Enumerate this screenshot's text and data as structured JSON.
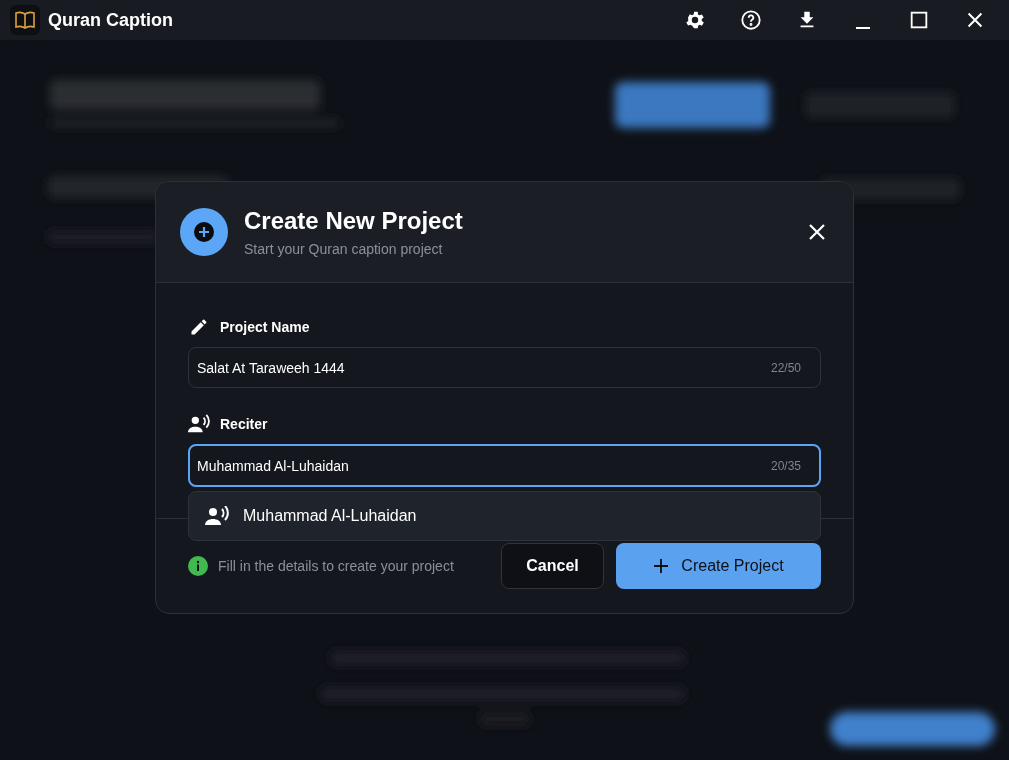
{
  "window": {
    "title": "Quran Caption"
  },
  "dialog": {
    "title": "Create New Project",
    "subtitle": "Start your Quran caption project",
    "fields": [
      {
        "label": "Project Name",
        "kind": "pencil",
        "value": "Salat At Taraweeh 1444",
        "counter": "22/50",
        "focused": false
      },
      {
        "label": "Reciter",
        "kind": "reciter",
        "value": "Muhammad Al-Luhaidan",
        "counter": "20/35",
        "focused": true,
        "suggestions": [
          {
            "label": "Muhammad Al-Luhaidan"
          }
        ]
      }
    ],
    "hint": "Fill in the details to create your project",
    "buttons": [
      {
        "label": "Cancel",
        "kind": "secondary"
      },
      {
        "label": "Create Project",
        "kind": "primary"
      }
    ]
  }
}
